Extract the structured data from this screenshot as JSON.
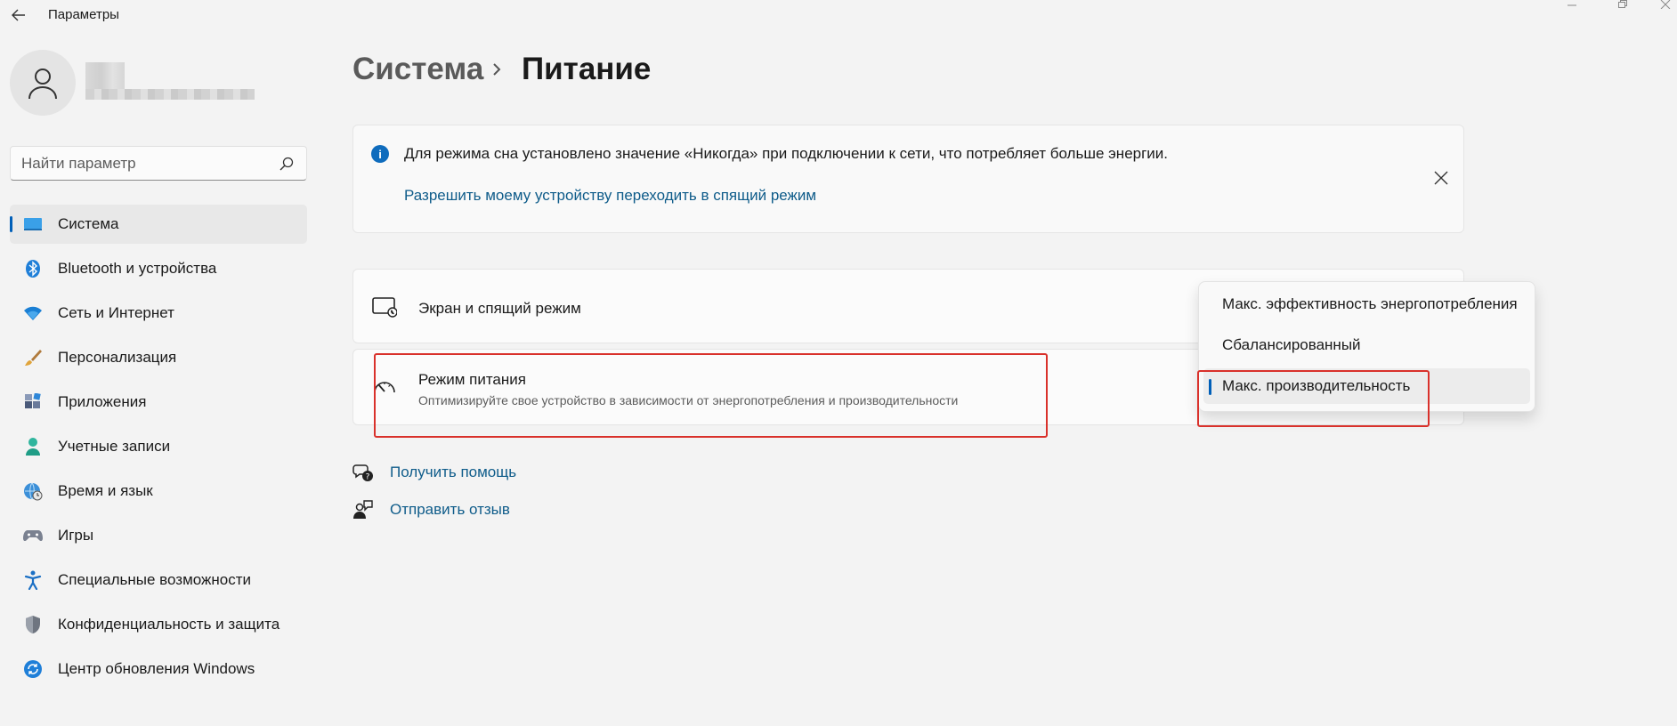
{
  "window": {
    "title": "Параметры"
  },
  "search": {
    "placeholder": "Найти параметр"
  },
  "sidebar": {
    "items": [
      {
        "label": "Система",
        "icon": "system-icon",
        "active": true
      },
      {
        "label": "Bluetooth и устройства",
        "icon": "bluetooth-icon"
      },
      {
        "label": "Сеть и Интернет",
        "icon": "wifi-icon"
      },
      {
        "label": "Персонализация",
        "icon": "brush-icon"
      },
      {
        "label": "Приложения",
        "icon": "apps-icon"
      },
      {
        "label": "Учетные записи",
        "icon": "account-icon"
      },
      {
        "label": "Время и язык",
        "icon": "globe-clock-icon"
      },
      {
        "label": "Игры",
        "icon": "gamepad-icon"
      },
      {
        "label": "Специальные возможности",
        "icon": "accessibility-icon"
      },
      {
        "label": "Конфиденциальность и защита",
        "icon": "shield-icon"
      },
      {
        "label": "Центр обновления Windows",
        "icon": "update-icon"
      }
    ]
  },
  "breadcrumb": {
    "parent": "Система",
    "current": "Питание"
  },
  "banner": {
    "message": "Для режима сна установлено значение «Никогда» при подключении к сети, что потребляет больше энергии.",
    "link": "Разрешить моему устройству переходить в спящий режим"
  },
  "settings": {
    "screen_sleep": {
      "title": "Экран и спящий режим"
    },
    "power_mode": {
      "title": "Режим питания",
      "subtitle": "Оптимизируйте свое устройство в зависимости от энергопотребления и производительности"
    }
  },
  "power_mode_options": [
    {
      "label": "Макс. эффективность энергопотребления"
    },
    {
      "label": "Сбалансированный"
    },
    {
      "label": "Макс. производительность",
      "selected": true
    }
  ],
  "help": {
    "get_help": "Получить помощь",
    "feedback": "Отправить отзыв"
  },
  "colors": {
    "accent": "#005fb8",
    "link": "#0f5c8a",
    "highlight": "#d9312b"
  }
}
